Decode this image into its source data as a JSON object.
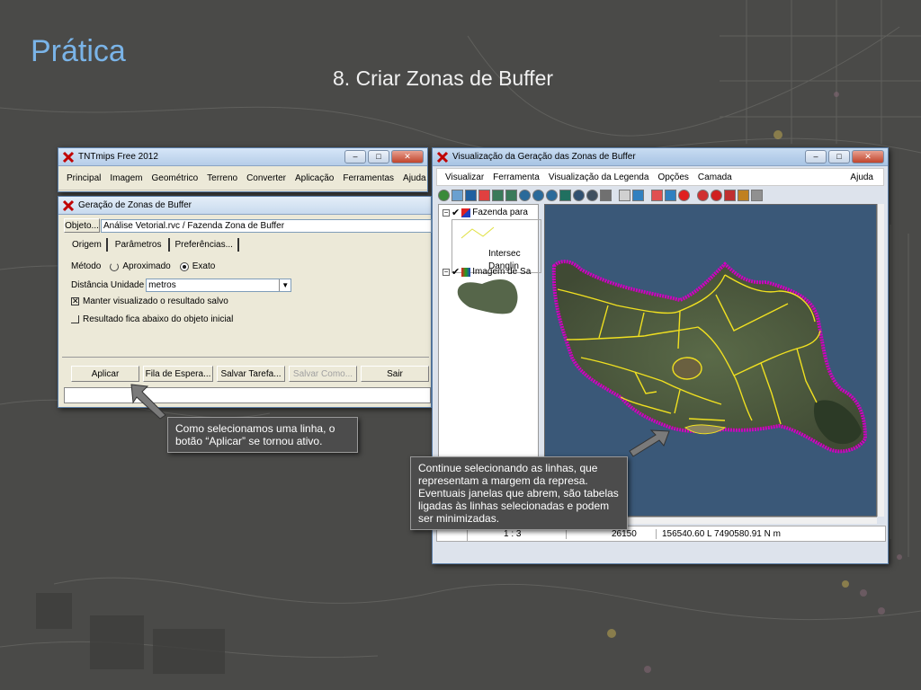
{
  "slide": {
    "title": "Prática",
    "subtitle": "8. Criar Zonas de Buffer"
  },
  "main_window": {
    "title": "TNTmips Free 2012",
    "menu": [
      "Principal",
      "Imagem",
      "Geométrico",
      "Terreno",
      "Converter",
      "Aplicação",
      "Ferramentas",
      "Ajuda"
    ]
  },
  "buffer_dialog": {
    "title": "Geração de Zonas de Buffer",
    "object_button": "Objeto...",
    "object_value": "Análise Vetorial.rvc / Fazenda Zona de Buffer",
    "tabs": [
      "Origem",
      "Parâmetros",
      "Preferências..."
    ],
    "method_label": "Método",
    "method_options": [
      "Aproximado",
      "Exato"
    ],
    "method_selected": "Exato",
    "distance_unit_label": "Distância Unidade",
    "distance_unit_value": "metros",
    "checkbox_keep": "Manter visualizado o resultado salvo",
    "checkbox_keep_checked": true,
    "checkbox_below": "Resultado fica abaixo do objeto inicial",
    "checkbox_below_checked": false,
    "buttons": [
      "Aplicar",
      "Fila de Espera...",
      "Salvar Tarefa...",
      "Salvar Como...",
      "Sair"
    ]
  },
  "view_window": {
    "title": "Visualização da Geração das Zonas de Buffer",
    "menu": [
      "Visualizar",
      "Ferramenta",
      "Visualização da Legenda",
      "Opções",
      "Camada"
    ],
    "menu_help": "Ajuda",
    "layers": {
      "layer1": "Fazenda para",
      "legend1": "Intersec",
      "legend2": "Danglin",
      "layer2": "Imagem de Sa"
    },
    "status": {
      "scale": "1 : 3",
      "value": "26150",
      "coords": "156540.60 L  7490580.91 N m"
    }
  },
  "callouts": {
    "apply": "Como selecionamos uma linha, o botão “Aplicar” se tornou ativo.",
    "continue": "Continue selecionando as linhas, que representam a margem da represa. Eventuais janelas que abrem, são tabelas ligadas às linhas selecionadas e podem ser minimizadas."
  },
  "colors": {
    "title_blue": "#7ab4e8",
    "buffer_magenta": "#d000c0",
    "selection_yellow": "#f0e020",
    "water_blue": "#3a5878"
  }
}
